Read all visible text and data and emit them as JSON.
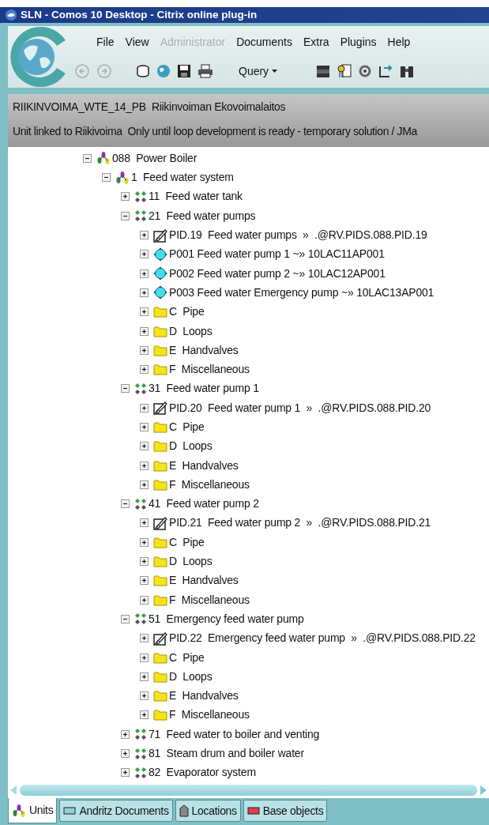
{
  "window": {
    "title": "SLN - Comos 10 Desktop - Citrix online plug-in"
  },
  "menu": [
    {
      "label": "File",
      "disabled": false
    },
    {
      "label": "View",
      "disabled": false
    },
    {
      "label": "Administrator",
      "disabled": true
    },
    {
      "label": "Documents",
      "disabled": false
    },
    {
      "label": "Extra",
      "disabled": false
    },
    {
      "label": "Plugins",
      "disabled": false
    },
    {
      "label": "Help",
      "disabled": false
    }
  ],
  "toolbar": {
    "query": "Query"
  },
  "header": {
    "line_1": "RIIKINVOIMA_WTE_14_PB  Riikinvoiman Ekovoimalaitos",
    "line_2": "Unit linked to Riikivoima  Only until loop development is ready - temporary solution / JMa"
  },
  "tree": [
    {
      "kind": "unit",
      "label": "088  Power Boiler",
      "expanded": true,
      "children": [
        {
          "kind": "unit",
          "label": "1  Feed water system",
          "expanded": true,
          "children": [
            {
              "kind": "group",
              "label": "11  Feed water tank",
              "expanded": false
            },
            {
              "kind": "group",
              "label": "21  Feed water pumps",
              "expanded": true,
              "children": [
                {
                  "kind": "pid",
                  "label": "PID.19  Feed water pumps  »  .@RV.PIDS.088.PID.19",
                  "expanded": false
                },
                {
                  "kind": "pump",
                  "label": "P001 Feed water pump 1 ~» 10LAC11AP001",
                  "expanded": false
                },
                {
                  "kind": "pump",
                  "label": "P002 Feed water pump 2 ~» 10LAC12AP001",
                  "expanded": false
                },
                {
                  "kind": "pump",
                  "label": "P003 Feed water Emergency pump ~» 10LAC13AP001",
                  "expanded": false
                },
                {
                  "kind": "folder",
                  "label": "C  Pipe",
                  "expanded": false
                },
                {
                  "kind": "folder",
                  "label": "D  Loops",
                  "expanded": false
                },
                {
                  "kind": "folder",
                  "label": "E  Handvalves",
                  "expanded": false
                },
                {
                  "kind": "folder",
                  "label": "F  Miscellaneous",
                  "expanded": false
                }
              ]
            },
            {
              "kind": "group",
              "label": "31  Feed water pump 1",
              "expanded": true,
              "children": [
                {
                  "kind": "pid",
                  "label": "PID.20  Feed water pump 1  »  .@RV.PIDS.088.PID.20",
                  "expanded": false
                },
                {
                  "kind": "folder",
                  "label": "C  Pipe",
                  "expanded": false
                },
                {
                  "kind": "folder",
                  "label": "D  Loops",
                  "expanded": false
                },
                {
                  "kind": "folder",
                  "label": "E  Handvalves",
                  "expanded": false
                },
                {
                  "kind": "folder",
                  "label": "F  Miscellaneous",
                  "expanded": false
                }
              ]
            },
            {
              "kind": "group",
              "label": "41  Feed water pump 2",
              "expanded": true,
              "children": [
                {
                  "kind": "pid",
                  "label": "PID.21  Feed water pump 2  »  .@RV.PIDS.088.PID.21",
                  "expanded": false
                },
                {
                  "kind": "folder",
                  "label": "C  Pipe",
                  "expanded": false
                },
                {
                  "kind": "folder",
                  "label": "D  Loops",
                  "expanded": false
                },
                {
                  "kind": "folder",
                  "label": "E  Handvalves",
                  "expanded": false
                },
                {
                  "kind": "folder",
                  "label": "F  Miscellaneous",
                  "expanded": false
                }
              ]
            },
            {
              "kind": "group",
              "label": "51  Emergency feed water pump",
              "expanded": true,
              "children": [
                {
                  "kind": "pid",
                  "label": "PID.22  Emergency feed water pump  »  .@RV.PIDS.088.PID.22",
                  "expanded": false
                },
                {
                  "kind": "folder",
                  "label": "C  Pipe",
                  "expanded": false
                },
                {
                  "kind": "folder",
                  "label": "D  Loops",
                  "expanded": false
                },
                {
                  "kind": "folder",
                  "label": "E  Handvalves",
                  "expanded": false
                },
                {
                  "kind": "folder",
                  "label": "F  Miscellaneous",
                  "expanded": false
                }
              ]
            },
            {
              "kind": "group",
              "label": "71  Feed water to boiler and venting",
              "expanded": false
            },
            {
              "kind": "group",
              "label": "81  Steam drum and boiler water",
              "expanded": false
            },
            {
              "kind": "group",
              "label": "82  Evaporator system",
              "expanded": false
            }
          ]
        }
      ]
    }
  ],
  "tabs": [
    {
      "kind": "unit",
      "label": "Units",
      "selected": true
    },
    {
      "kind": "document",
      "label": "Andritz Documents",
      "selected": false
    },
    {
      "kind": "location",
      "label": "Locations",
      "selected": false
    },
    {
      "kind": "base",
      "label": "Base objects",
      "selected": false
    }
  ]
}
